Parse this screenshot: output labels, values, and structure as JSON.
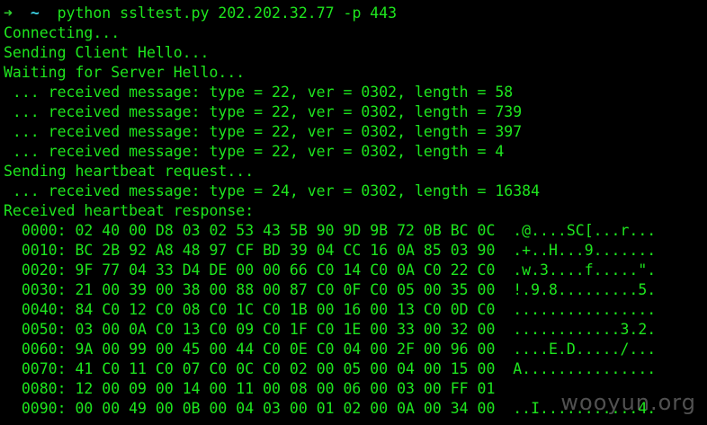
{
  "prompt": {
    "arrow": "➜",
    "tilde": "~",
    "command": "python ssltest.py 202.202.32.77 -p 443"
  },
  "output_lines": [
    "Connecting...",
    "Sending Client Hello...",
    "Waiting for Server Hello...",
    " ... received message: type = 22, ver = 0302, length = 58",
    " ... received message: type = 22, ver = 0302, length = 739",
    " ... received message: type = 22, ver = 0302, length = 397",
    " ... received message: type = 22, ver = 0302, length = 4",
    "Sending heartbeat request...",
    " ... received message: type = 24, ver = 0302, length = 16384",
    "Received heartbeat response:"
  ],
  "hexdump": [
    {
      "offset": "0000:",
      "bytes": "02 40 00 D8 03 02 53 43 5B 90 9D 9B 72 0B BC 0C",
      "ascii": ".@....SC[...r..."
    },
    {
      "offset": "0010:",
      "bytes": "BC 2B 92 A8 48 97 CF BD 39 04 CC 16 0A 85 03 90",
      "ascii": ".+..H...9......."
    },
    {
      "offset": "0020:",
      "bytes": "9F 77 04 33 D4 DE 00 00 66 C0 14 C0 0A C0 22 C0",
      "ascii": ".w.3....f.....\"."
    },
    {
      "offset": "0030:",
      "bytes": "21 00 39 00 38 00 88 00 87 C0 0F C0 05 00 35 00",
      "ascii": "!.9.8.........5."
    },
    {
      "offset": "0040:",
      "bytes": "84 C0 12 C0 08 C0 1C C0 1B 00 16 00 13 C0 0D C0",
      "ascii": "................"
    },
    {
      "offset": "0050:",
      "bytes": "03 00 0A C0 13 C0 09 C0 1F C0 1E 00 33 00 32 00",
      "ascii": "............3.2."
    },
    {
      "offset": "0060:",
      "bytes": "9A 00 99 00 45 00 44 C0 0E C0 04 00 2F 00 96 00",
      "ascii": "....E.D...../..."
    },
    {
      "offset": "0070:",
      "bytes": "41 C0 11 C0 07 C0 0C C0 02 00 05 00 04 00 15 00",
      "ascii": "A..............."
    },
    {
      "offset": "0080:",
      "bytes": "12 00 09 00 14 00 11 00 08 00 06 00 03 00 FF 01",
      "ascii": ""
    },
    {
      "offset": "0090:",
      "bytes": "00 00 49 00 0B 00 04 03 00 01 02 00 0A 00 34 00",
      "ascii": "..I...........4."
    }
  ],
  "watermark": "wooyun.org",
  "colors": {
    "background": "#000000",
    "text": "#1ee61e",
    "prompt_arrow": "#2fd22f",
    "prompt_tilde": "#3cd3e6"
  }
}
